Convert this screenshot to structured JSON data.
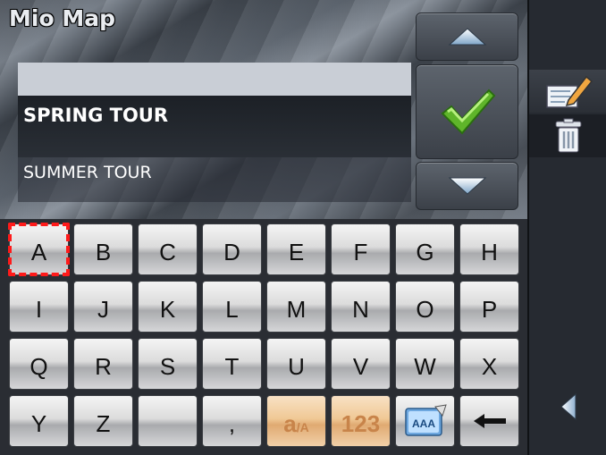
{
  "app": {
    "title": "Mio Map"
  },
  "list": {
    "items": [
      "",
      "SPRING TOUR",
      "SUMMER TOUR"
    ]
  },
  "keyboard": {
    "rows": [
      [
        "A",
        "B",
        "C",
        "D",
        "E",
        "F",
        "G",
        "H"
      ],
      [
        "I",
        "J",
        "K",
        "L",
        "M",
        "N",
        "O",
        "P"
      ],
      [
        "Q",
        "R",
        "S",
        "T",
        "U",
        "V",
        "W",
        "X"
      ],
      [
        "Y",
        "Z",
        "",
        ",",
        "a/A",
        "123",
        "",
        ""
      ]
    ],
    "case_key": {
      "big": "a",
      "small": "/A"
    },
    "numbers_key": "123",
    "special_icons": {
      "fonts": "abc-fonts-icon",
      "backspace": "backspace-arrow-icon"
    }
  },
  "colors": {
    "check_green": "#5fb52a",
    "selection_red": "#ff1a1a",
    "key_orange": "#f0c996"
  }
}
